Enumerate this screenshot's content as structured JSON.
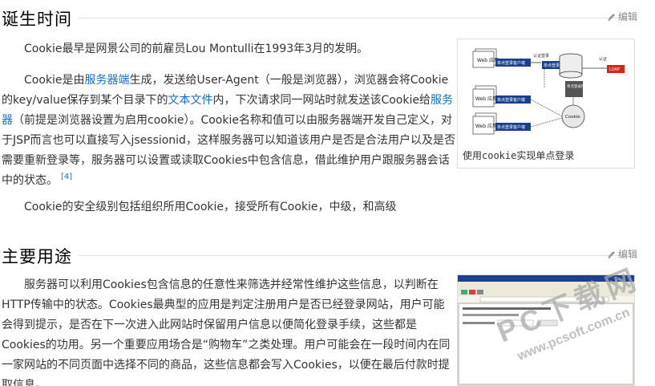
{
  "sections": [
    {
      "title": "诞生时间",
      "edit_label": "编辑",
      "paragraphs": [
        {
          "text": "Cookie最早是网景公司的前雇员Lou Montulli在1993年3月的发明。"
        },
        {
          "parts": [
            {
              "t": "Cookie是由"
            },
            {
              "t": "服务器端",
              "link": true
            },
            {
              "t": "生成，发送给User-Agent（一般是浏览器），浏览器会将Cookie的key/value保存到某个目录下的"
            },
            {
              "t": "文本文件",
              "link": true
            },
            {
              "t": "内，下次请求同一网站时就发送该Cookie给"
            },
            {
              "t": "服务器",
              "link": true
            },
            {
              "t": "（前提是浏览器设置为启用cookie）。Cookie名称和值可以由服务器端开发自己定义，对于JSP而言也可以直接写入jsessionid，这样服务器可以知道该用户是否是合法用户以及是否需要重新登录等，服务器可以设置或读取Cookies中包含信息，借此维护用户跟服务器会话中的状态。"
            }
          ],
          "ref": "[4]"
        },
        {
          "text": "Cookie的安全级别包括组织所用Cookie，接受所有Cookie，中级，和高级"
        }
      ],
      "figure_caption": "使用cookie实现单点登录",
      "diagram_labels": {
        "web_app": "Web 应用",
        "sso_client": "单点登录客户端",
        "auth_login": "认证登录",
        "sso_server": "单点登录服务端",
        "user_mgmt": "单点登录用户管理",
        "ldap": "LDAP",
        "auth": "认证",
        "cookie": "Cookie",
        "store": "服务器"
      }
    },
    {
      "title": "主要用途",
      "edit_label": "编辑",
      "paragraphs": [
        {
          "text": "服务器可以利用Cookies包含信息的任意性来筛选并经常性维护这些信息，以判断在HTTP传输中的状态。Cookies最典型的应用是判定注册用户是否已经登录网站，用户可能会得到提示，是否在下一次进入此网站时保留用户信息以便简化登录手续，这些都是Cookies的功用。另一个重要应用场合是“购物车”之类处理。用户可能会在一段时间内在同一家网站的不同页面中选择不同的商品，这些信息都会写入Cookies，以便在最后付款时提取信息。"
        }
      ]
    }
  ],
  "watermark": {
    "big": "PC下载网",
    "small": "www.pcsoft.com.cn"
  },
  "colors": {
    "link": "#136ec2",
    "ldap_red": "#d9241c",
    "box_blue": "#1a3f8f"
  }
}
